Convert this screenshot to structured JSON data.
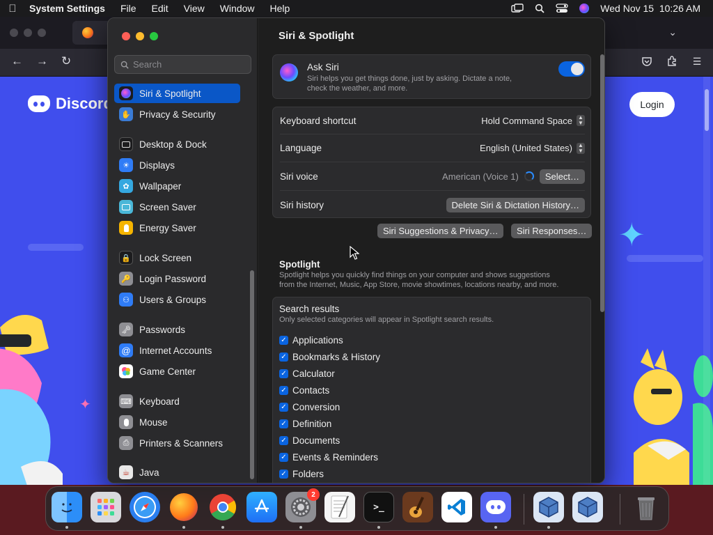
{
  "menubar": {
    "app": "System Settings",
    "items": [
      "File",
      "Edit",
      "View",
      "Window",
      "Help"
    ],
    "clock": "Wed Nov 15  10:26 AM"
  },
  "browser": {
    "login_label": "Login",
    "site_name": "Discord"
  },
  "sidebar": {
    "search_placeholder": "Search",
    "items": [
      {
        "label": "Siri & Spotlight",
        "icon": "siri-icon",
        "color": "#1c1c1e"
      },
      {
        "label": "Privacy & Security",
        "icon": "hand-icon",
        "color": "#3a7bd5"
      },
      {
        "label": "Desktop & Dock",
        "icon": "dock-icon",
        "color": "#1c1c1e"
      },
      {
        "label": "Displays",
        "icon": "sun-icon",
        "color": "#2f7cf6"
      },
      {
        "label": "Wallpaper",
        "icon": "flower-icon",
        "color": "#35a8e0"
      },
      {
        "label": "Screen Saver",
        "icon": "screen-saver-icon",
        "color": "#4ab7d8"
      },
      {
        "label": "Energy Saver",
        "icon": "bulb-icon",
        "color": "#f5b400"
      },
      {
        "label": "Lock Screen",
        "icon": "lock-icon",
        "color": "#1c1c1e"
      },
      {
        "label": "Login Password",
        "icon": "key-lock-icon",
        "color": "#8e8e93"
      },
      {
        "label": "Users & Groups",
        "icon": "users-icon",
        "color": "#2f7cf6"
      },
      {
        "label": "Passwords",
        "icon": "key-icon",
        "color": "#8e8e93"
      },
      {
        "label": "Internet Accounts",
        "icon": "at-icon",
        "color": "#2f7cf6"
      },
      {
        "label": "Game Center",
        "icon": "game-center-icon",
        "color": "#ffffff"
      },
      {
        "label": "Keyboard",
        "icon": "keyboard-icon",
        "color": "#8e8e93"
      },
      {
        "label": "Mouse",
        "icon": "mouse-icon",
        "color": "#8e8e93"
      },
      {
        "label": "Printers & Scanners",
        "icon": "printer-icon",
        "color": "#8e8e93"
      },
      {
        "label": "Java",
        "icon": "java-icon",
        "color": "#e8e8e8"
      }
    ]
  },
  "content": {
    "title": "Siri & Spotlight",
    "ask_siri": {
      "title": "Ask Siri",
      "desc_1": "Siri helps you get things done, just by asking. Dictate a note,",
      "desc_2": "check the weather, and more.",
      "enabled": true
    },
    "keyboard_shortcut": {
      "label": "Keyboard shortcut",
      "value": "Hold Command Space"
    },
    "language": {
      "label": "Language",
      "value": "English (United States)"
    },
    "siri_voice": {
      "label": "Siri voice",
      "value": "American (Voice 1)",
      "button": "Select…"
    },
    "siri_history": {
      "label": "Siri history",
      "button": "Delete Siri & Dictation History…"
    },
    "suggestions_button": "Siri Suggestions & Privacy…",
    "responses_button": "Siri Responses…",
    "spotlight": {
      "title": "Spotlight",
      "desc_1": "Spotlight helps you quickly find things on your computer and shows suggestions",
      "desc_2": "from the Internet, Music, App Store, movie showtimes, locations nearby, and more."
    },
    "search_results": {
      "title": "Search results",
      "desc": "Only selected categories will appear in Spotlight search results.",
      "items": [
        "Applications",
        "Bookmarks & History",
        "Calculator",
        "Contacts",
        "Conversion",
        "Definition",
        "Documents",
        "Events & Reminders",
        "Folders"
      ]
    }
  },
  "dock": {
    "apps": [
      {
        "name": "Finder",
        "color": "#2c8ef8"
      },
      {
        "name": "Launchpad",
        "color": "#d9d9dd"
      },
      {
        "name": "Safari",
        "color": "#2a7ff0"
      },
      {
        "name": "Firefox",
        "color": "#ff7a1a"
      },
      {
        "name": "Chrome",
        "color": "#ffffff"
      },
      {
        "name": "App Store",
        "color": "#1e8bf5"
      },
      {
        "name": "System Settings",
        "color": "#8e8e93"
      },
      {
        "name": "TextEdit",
        "color": "#f5f5f5"
      },
      {
        "name": "Terminal",
        "color": "#111111"
      },
      {
        "name": "GarageBand",
        "color": "#6b3a1e"
      },
      {
        "name": "VS Code",
        "color": "#ffffff"
      },
      {
        "name": "Discord",
        "color": "#5865f2"
      },
      {
        "name": "VirtualBox",
        "color": "#dbe6f5"
      },
      {
        "name": "VirtualBox 2",
        "color": "#dbe6f5"
      },
      {
        "name": "Trash",
        "color": "#6b6b6d"
      }
    ],
    "settings_badge": "2"
  }
}
